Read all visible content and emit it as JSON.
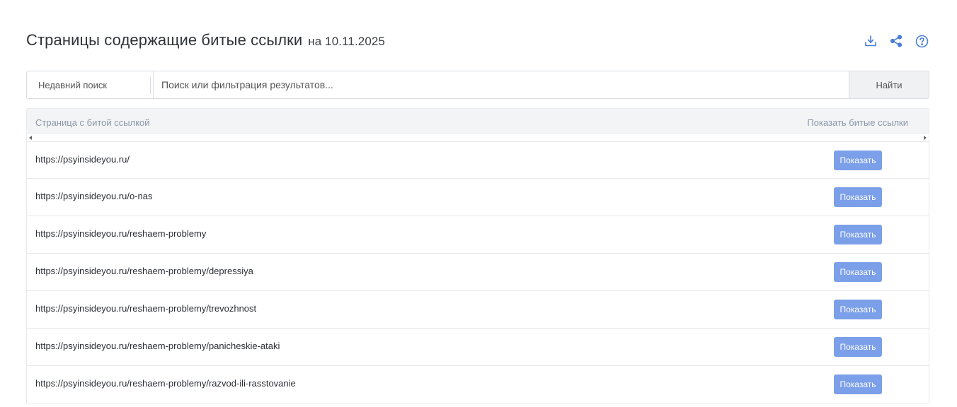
{
  "header": {
    "title": "Страницы содержащие битые ссылки",
    "date": "на 10.11.2025",
    "icons": [
      "download-icon",
      "share-icon",
      "help-icon"
    ]
  },
  "search": {
    "recent_label": "Недавний поиск",
    "placeholder": "Поиск или фильтрация результатов...",
    "find_label": "Найти"
  },
  "table": {
    "col_page": "Страница с битой ссылкой",
    "col_show": "Показать битые ссылки",
    "rows": [
      {
        "url": "https://psyinsideyou.ru/",
        "button": "Показать"
      },
      {
        "url": "https://psyinsideyou.ru/o-nas",
        "button": "Показать"
      },
      {
        "url": "https://psyinsideyou.ru/reshaem-problemy",
        "button": "Показать"
      },
      {
        "url": "https://psyinsideyou.ru/reshaem-problemy/depressiya",
        "button": "Показать"
      },
      {
        "url": "https://psyinsideyou.ru/reshaem-problemy/trevozhnost",
        "button": "Показать"
      },
      {
        "url": "https://psyinsideyou.ru/reshaem-problemy/panicheskie-ataki",
        "button": "Показать"
      },
      {
        "url": "https://psyinsideyou.ru/reshaem-problemy/razvod-ili-rasstovanie",
        "button": "Показать"
      }
    ]
  },
  "colors": {
    "accent": "#7b9fe8",
    "icon": "#4a7fd6",
    "header_bg": "#f3f4f6",
    "muted_text": "#8a96a8"
  }
}
